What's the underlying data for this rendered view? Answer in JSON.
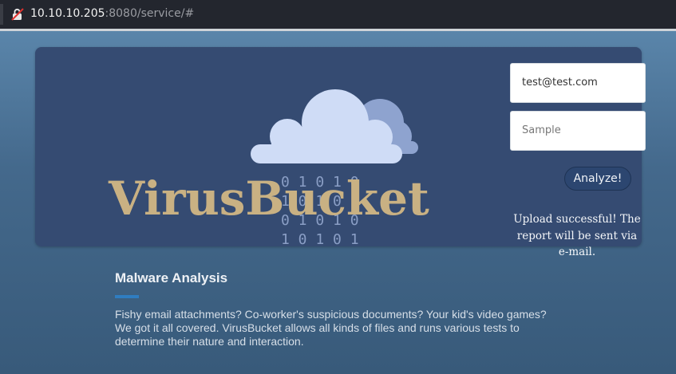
{
  "browser": {
    "url_host": "10.10.10.205",
    "url_rest": ":8080/service/#"
  },
  "hero": {
    "logo_text": "VirusBucket",
    "binary_rows": [
      "0 1 0 1 0",
      "1 0 1 0 1",
      "0 1 0 1 0",
      "1 0 1 0 1"
    ]
  },
  "form": {
    "email_value": "test@test.com",
    "sample_placeholder": "Sample",
    "analyze_label": "Analyze!",
    "status_message": "Upload successful! The report will be sent via e-mail."
  },
  "section": {
    "title": "Malware Analysis",
    "description": "Fishy email attachments? Co-worker's suspicious documents? Your kid's video games? We got it all covered. VirusBucket allows all kinds of files and runs various tests to determine their nature and interaction."
  },
  "colors": {
    "hero_bg": "#354b72",
    "logo": "#c9b183",
    "accent": "#2f7dc0"
  }
}
